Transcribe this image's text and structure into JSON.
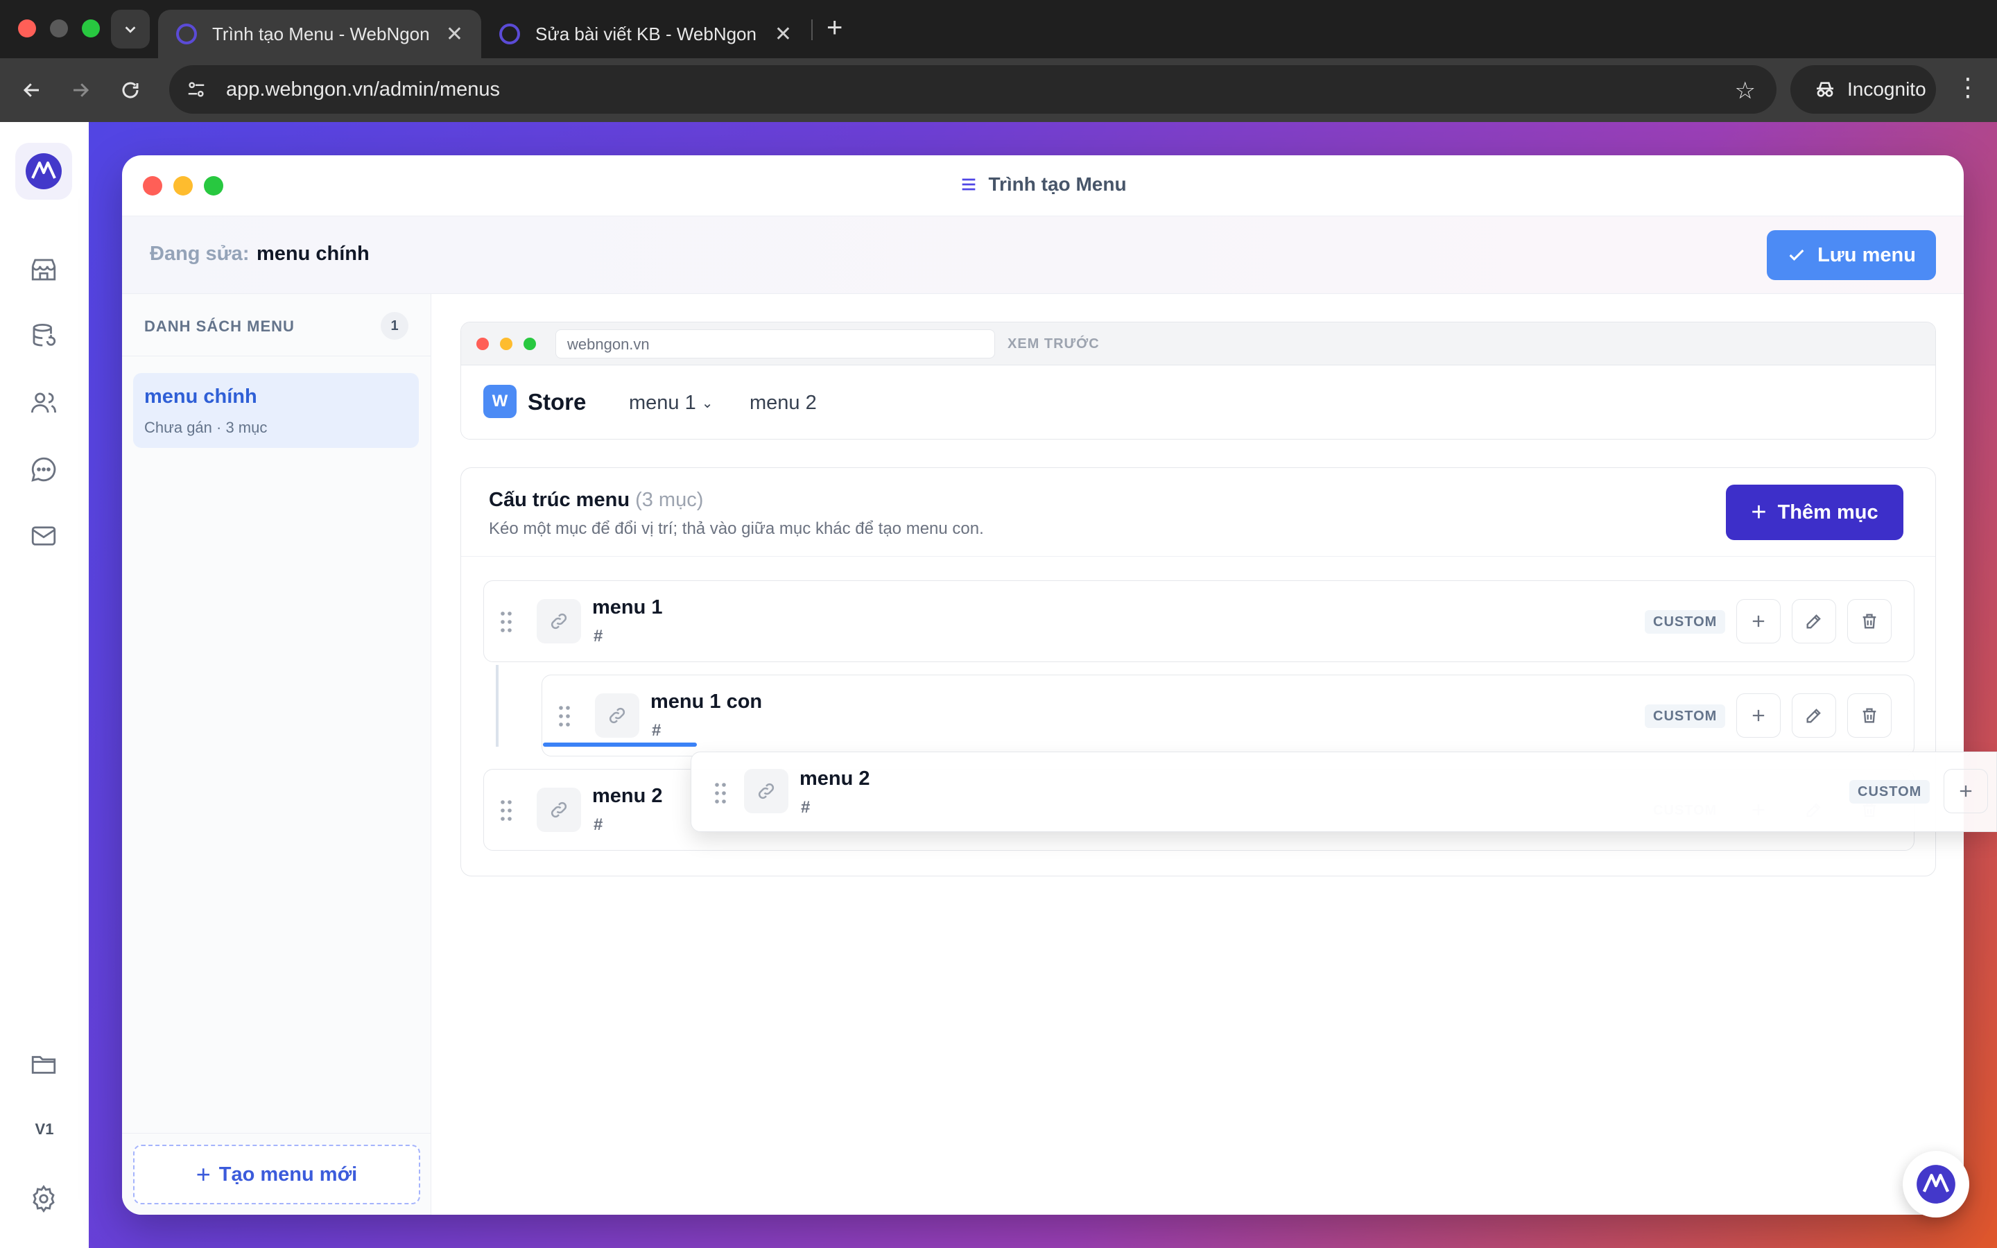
{
  "browser": {
    "tabs": [
      {
        "title": "Trình tạo Menu - WebNgon",
        "active": true
      },
      {
        "title": "Sửa bài viết KB - WebNgon",
        "active": false
      }
    ],
    "url": "app.webngon.vn/admin/menus",
    "incognito_label": "Incognito"
  },
  "rail": {
    "icons": [
      "store-icon",
      "database-icon",
      "users-icon",
      "chat-icon",
      "mail-icon",
      "folder-icon",
      "settings-icon"
    ],
    "version": "V1"
  },
  "window": {
    "title": "Trình tạo Menu",
    "editing_label": "Đang sửa:",
    "editing_value": "menu chính",
    "save_label": "Lưu menu"
  },
  "sidebar": {
    "heading": "DANH SÁCH MENU",
    "count": "1",
    "items": [
      {
        "name": "menu chính",
        "meta": "Chưa gán · 3 mục"
      }
    ],
    "new_menu_label": "Tạo menu mới"
  },
  "preview": {
    "url": "webngon.vn",
    "label": "XEM TRƯỚC",
    "logo_letter": "W",
    "store_name": "Store",
    "nav": [
      {
        "label": "menu 1",
        "has_children": true
      },
      {
        "label": "menu 2",
        "has_children": false
      }
    ]
  },
  "structure": {
    "title": "Cấu trúc menu",
    "count_text": "(3 mục)",
    "hint": "Kéo một mục để đổi vị trí; thả vào giữa mục khác để tạo menu con.",
    "add_label": "Thêm mục",
    "items": [
      {
        "name": "menu 1",
        "href": "#",
        "type": "CUSTOM",
        "level": 0
      },
      {
        "name": "menu 1 con",
        "href": "#",
        "type": "CUSTOM",
        "level": 1
      },
      {
        "name": "menu 2",
        "href": "#",
        "type": "CUSTOM",
        "level": 0
      }
    ],
    "dragging": {
      "name": "menu 2",
      "href": "#",
      "type": "CUSTOM"
    }
  },
  "colors": {
    "primary": "#4c8bf5",
    "accent": "#3d2fc9",
    "selected_bg": "#e8effd"
  }
}
